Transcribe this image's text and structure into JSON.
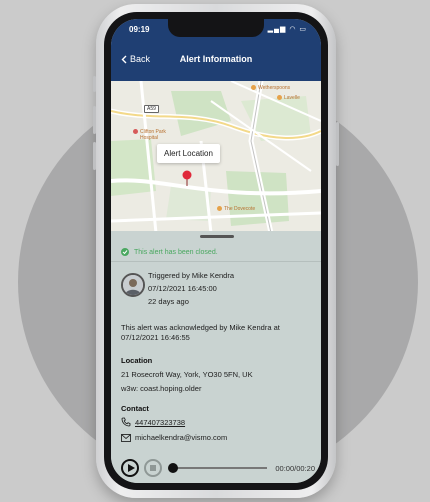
{
  "status_bar": {
    "time": "09:19"
  },
  "nav": {
    "back_label": "Back",
    "title": "Alert Information"
  },
  "map": {
    "callout": "Alert Location",
    "road_badge": "A59",
    "places": {
      "wetherspoons": "Wetherspoons",
      "lavelle": "Lavelle",
      "clifton_park_line1": "Clifton Park",
      "clifton_park_line2": "Hospital",
      "dovecote": "The Dovecote"
    }
  },
  "alert": {
    "status": "This alert has been closed.",
    "triggered_by": "Triggered by Mike Kendra",
    "triggered_time": "07/12/2021 16:45:00",
    "relative_time": "22 days ago",
    "acknowledged": "This alert was acknowledged by Mike Kendra at 07/12/2021 16:46:55"
  },
  "location": {
    "heading": "Location",
    "address": "21 Rosecroft Way, York, YO30 5FN, UK",
    "w3w": "w3w: coast.hoping.older"
  },
  "contact": {
    "heading": "Contact",
    "phone": "447407323738",
    "email": "michaelkendra@vismo.com"
  },
  "player": {
    "time": "00:00/00:20",
    "progress": 0
  },
  "colors": {
    "header": "#1f3f73",
    "panel": "#c9d3d1",
    "success": "#4aa860",
    "pin": "#e0283a"
  }
}
